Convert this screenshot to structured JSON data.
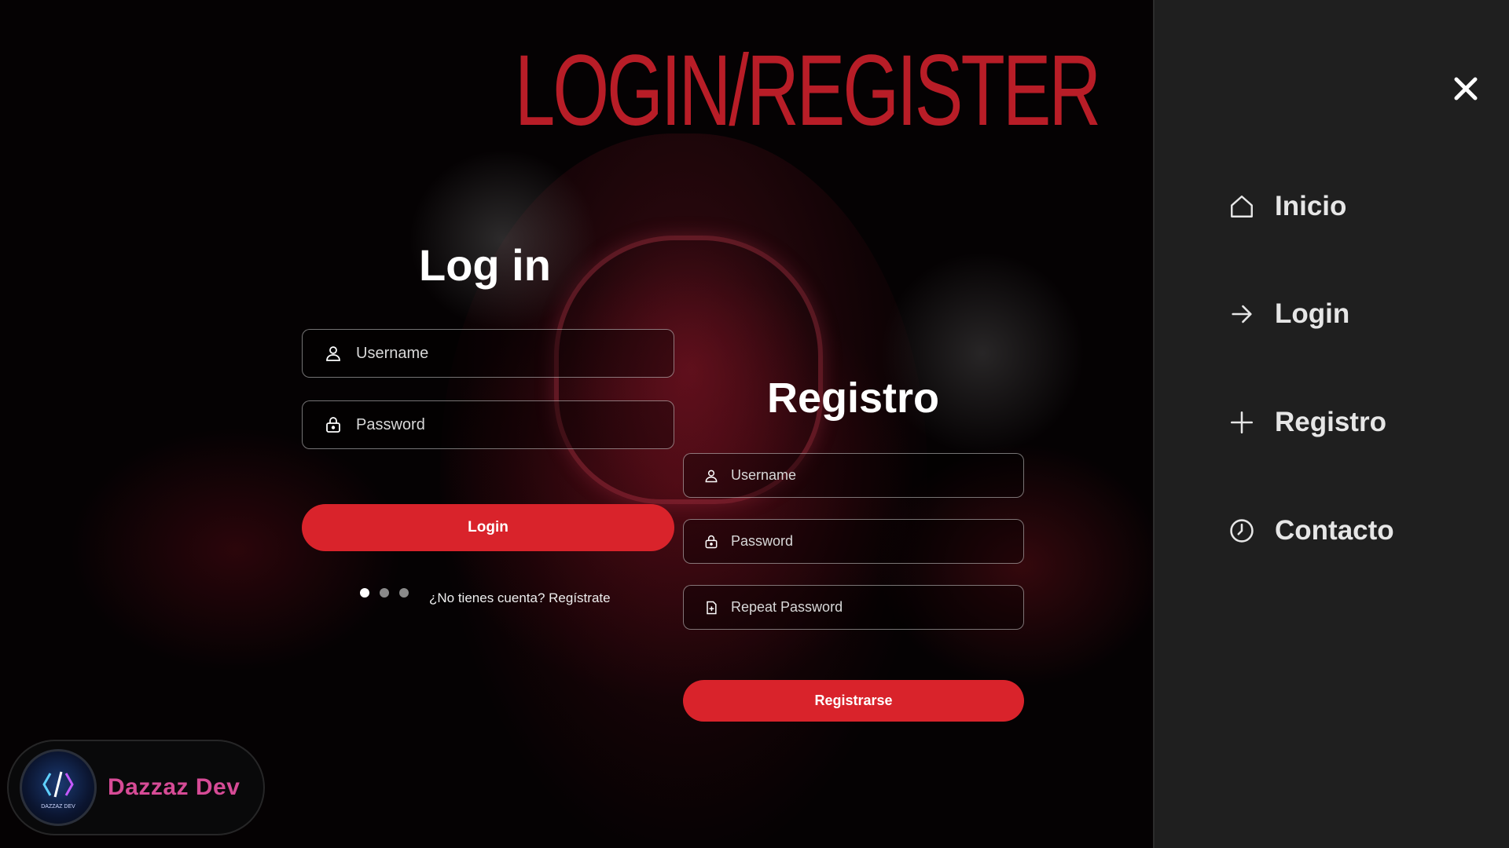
{
  "page": {
    "title": "LOGIN/REGISTER"
  },
  "login": {
    "title": "Log in",
    "username_placeholder": "Username",
    "password_placeholder": "Password",
    "button_label": "Login",
    "signup_link": "¿No tienes cuenta? Regístrate",
    "carousel": {
      "total": 3,
      "active": 1
    }
  },
  "register": {
    "title": "Registro",
    "username_placeholder": "Username",
    "password_placeholder": "Password",
    "repeat_password_placeholder": "Repeat Password",
    "button_label": "Registrarse"
  },
  "sidebar": {
    "items": [
      {
        "label": "Inicio",
        "icon": "home-icon"
      },
      {
        "label": "Login",
        "icon": "arrow-right-icon"
      },
      {
        "label": "Registro",
        "icon": "plus-icon"
      },
      {
        "label": "Contacto",
        "icon": "clock-icon"
      }
    ],
    "close_icon": "close-icon"
  },
  "brand": {
    "name": "Dazzaz Dev",
    "logo_text": "DAZZAZ DEV"
  },
  "colors": {
    "accent": "#d9232b",
    "title": "#b81d27",
    "sidebar_bg": "#1f1f1f",
    "brand_text": "#d64b96"
  }
}
